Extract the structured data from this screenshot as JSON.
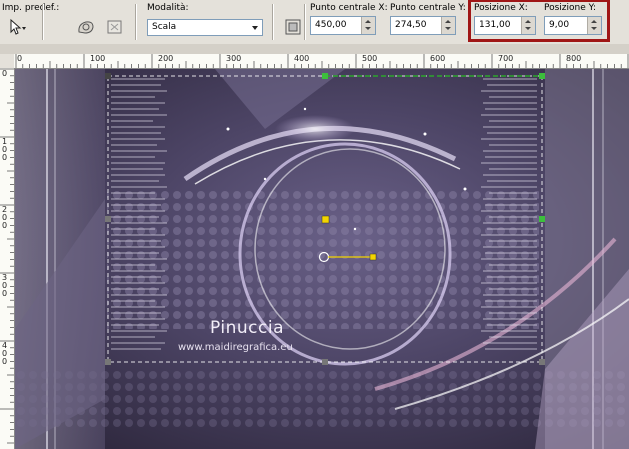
{
  "toolbar": {
    "preset_label": "Imp. predef.:",
    "mode_label": "Modalità:",
    "mode_value": "Scala",
    "center_x_label": "Punto centrale X:",
    "center_x_value": "450,00",
    "center_y_label": "Punto centrale Y:",
    "center_y_value": "274,50",
    "pos_x_label": "Posizione X:",
    "pos_x_value": "131,00",
    "pos_y_label": "Posizione Y:",
    "pos_y_value": "9,00",
    "highlight_color": "#a01616"
  },
  "ruler": {
    "h_ticks": [
      "0",
      "100",
      "200",
      "300",
      "400",
      "500",
      "600",
      "700",
      "800"
    ],
    "v_ticks": [
      "0",
      "1\n0\n0",
      "2\n0\n0",
      "3\n0\n0",
      "4\n0\n0"
    ]
  },
  "canvas": {
    "watermark_name": "Pinuccia",
    "watermark_url": "www.maidiregrafica.eu",
    "background_color": "#4a4260",
    "accent_color": "#c9b6e8",
    "handle_color": "#f2d400"
  },
  "icons": {
    "pointer": "cursor-arrow-icon",
    "deform": "deform-tool-icon",
    "reset": "reset-icon",
    "center": "center-target-icon"
  }
}
